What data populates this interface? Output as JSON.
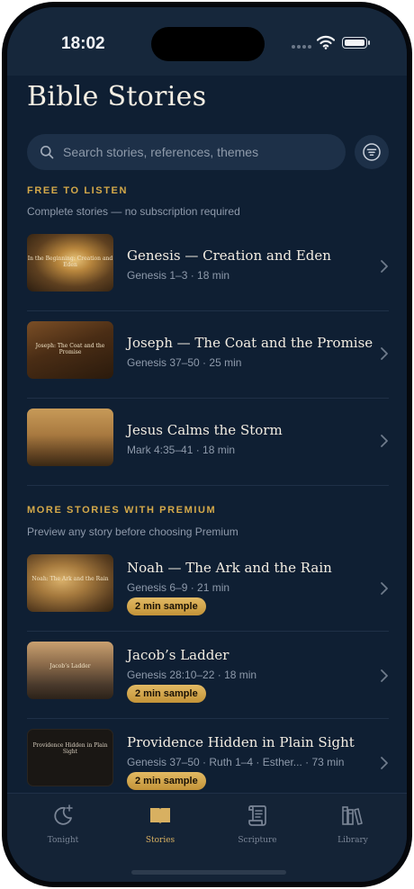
{
  "status": {
    "time": "18:02"
  },
  "header": {
    "title": "Bible Stories"
  },
  "search": {
    "placeholder": "Search stories, references, themes"
  },
  "free_section": {
    "label": "FREE TO LISTEN",
    "subtitle": "Complete stories — no subscription required",
    "items": [
      {
        "title": "Genesis — Creation and Eden",
        "meta": "Genesis 1–3 · 18 min",
        "thumb_text": "In the Beginning: Creation and Eden"
      },
      {
        "title": "Joseph — The Coat and the Promise",
        "meta": "Genesis 37–50 · 25 min",
        "thumb_text": "Joseph: The Coat and the Promise"
      },
      {
        "title": "Jesus Calms the Storm",
        "meta": "Mark 4:35–41 · 18 min",
        "thumb_text": ""
      }
    ]
  },
  "premium_section": {
    "label": "MORE STORIES WITH PREMIUM",
    "subtitle": "Preview any story before choosing Premium",
    "items": [
      {
        "title": "Noah — The Ark and the Rain",
        "meta": "Genesis 6–9 · 21 min",
        "badge": "2 min sample",
        "thumb_text": "Noah: The Ark and the Rain"
      },
      {
        "title": "Jacob’s Ladder",
        "meta": "Genesis 28:10–22 · 18 min",
        "badge": "2 min sample",
        "thumb_text": "Jacob’s Ladder"
      },
      {
        "title": "Providence Hidden in Plain Sight",
        "meta": "Genesis 37–50 · Ruth 1–4 · Esther... · 73 min",
        "badge": "2 min sample",
        "thumb_text": "Providence Hidden in Plain Sight"
      }
    ]
  },
  "tabs": [
    {
      "label": "Tonight",
      "icon": "moon-stars-icon",
      "active": false
    },
    {
      "label": "Stories",
      "icon": "open-book-icon",
      "active": true
    },
    {
      "label": "Scripture",
      "icon": "scroll-icon",
      "active": false
    },
    {
      "label": "Library",
      "icon": "books-icon",
      "active": false
    }
  ],
  "colors": {
    "background": "#0f1f33",
    "accent": "#d4a94a",
    "badge": "#d9ad52"
  }
}
